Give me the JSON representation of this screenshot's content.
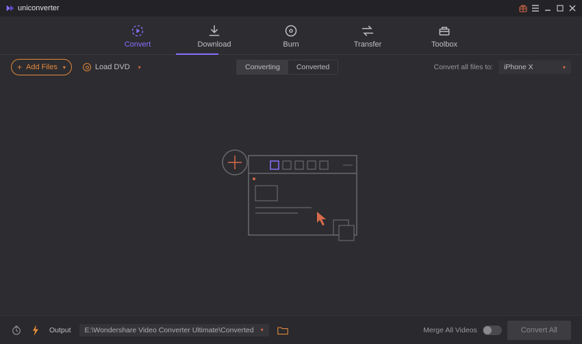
{
  "app": {
    "brand": "uniconverter"
  },
  "tabs": [
    {
      "key": "convert",
      "label": "Convert",
      "active": true
    },
    {
      "key": "download",
      "label": "Download",
      "active": false
    },
    {
      "key": "burn",
      "label": "Burn",
      "active": false
    },
    {
      "key": "transfer",
      "label": "Transfer",
      "active": false
    },
    {
      "key": "toolbox",
      "label": "Toolbox",
      "active": false
    }
  ],
  "toolbar": {
    "add_files_label": "Add Files",
    "load_dvd_label": "Load DVD",
    "segment": {
      "converting_label": "Converting",
      "converted_label": "Converted",
      "active": "converting"
    },
    "convert_to_label": "Convert all files to:",
    "device_selected": "iPhone X"
  },
  "bottom": {
    "output_label": "Output",
    "output_path": "E:\\Wondershare Video Converter Ultimate\\Converted",
    "merge_label": "Merge All Videos",
    "merge_on": false,
    "convert_all_label": "Convert All"
  },
  "colors": {
    "accent_purple": "#8a6fff",
    "accent_orange": "#e28a3c",
    "accent_red": "#d86b4a"
  }
}
